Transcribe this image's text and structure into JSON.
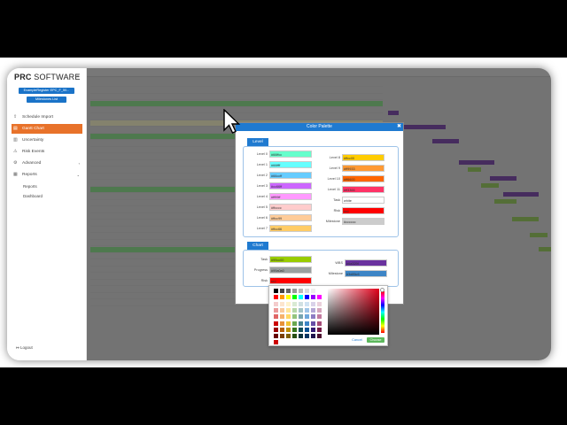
{
  "app": {
    "logo_bold": "RC",
    "logo_light": " SOFTWARE",
    "logo_prefix": "P"
  },
  "sidebar": {
    "project_button": "ExampleRegister EPC_F_50...",
    "milestone_button": "Milestones List",
    "items": [
      {
        "label": "Schedule Import",
        "icon": "upload-icon"
      },
      {
        "label": "Gantt Chart",
        "icon": "gantt-icon",
        "active": true
      },
      {
        "label": "Uncertainty",
        "icon": "chart-icon"
      },
      {
        "label": "Risk Events",
        "icon": "warning-icon"
      },
      {
        "label": "Advanced",
        "icon": "gear-icon"
      },
      {
        "label": "Reports",
        "icon": "report-icon"
      }
    ],
    "sub_items": [
      "Reports",
      "Dashboard"
    ],
    "logout": "Logout"
  },
  "modal": {
    "title": "Color Palette",
    "level_section": "Level",
    "chart_section": "Chart",
    "levels_left": [
      {
        "label": "Level 0",
        "value": "#66ffcc",
        "color": "#66ffcc"
      },
      {
        "label": "Level 1",
        "value": "#66ffff",
        "color": "#66ffff"
      },
      {
        "label": "Level 2",
        "value": "#66ccff",
        "color": "#66ccff"
      },
      {
        "label": "Level 3",
        "value": "#cc66ff",
        "color": "#cc66ff"
      },
      {
        "label": "Level 4",
        "value": "#ff99ff",
        "color": "#ff99ff"
      },
      {
        "label": "Level 5",
        "value": "#ffcccc",
        "color": "#ffcccc"
      },
      {
        "label": "Level 6",
        "value": "#ffcc99",
        "color": "#ffcc99"
      },
      {
        "label": "Level 7",
        "value": "#ffcc66",
        "color": "#ffcc66"
      }
    ],
    "levels_right": [
      {
        "label": "Level 8",
        "value": "#ffcc00",
        "color": "#ffcc00"
      },
      {
        "label": "Level 9",
        "value": "#ff9933",
        "color": "#ff9933"
      },
      {
        "label": "Level 10",
        "value": "#ff6600",
        "color": "#ff6600"
      },
      {
        "label": "Level 11",
        "value": "#ff3366",
        "color": "#ff3366"
      },
      {
        "label": "Task",
        "value": "white",
        "color": "#ffffff"
      },
      {
        "label": "Risk",
        "value": "red",
        "color": "#ff0000"
      },
      {
        "label": "Milestone",
        "value": "#cccccc",
        "color": "#cccccc"
      }
    ],
    "chart_left": [
      {
        "label": "Task",
        "value": "#99cc00",
        "color": "#99cc00"
      },
      {
        "label": "Progress",
        "value": "#99a0a0",
        "color": "#99a0a0"
      },
      {
        "label": "Risk",
        "value": "red",
        "color": "#ff0000"
      }
    ],
    "chart_right": [
      {
        "label": "WBS",
        "value": "#6a329f",
        "color": "#6a329f"
      },
      {
        "label": "Milestone",
        "value": "#3d85c6",
        "color": "#3d85c6"
      }
    ]
  },
  "picker": {
    "cancel_label": "Cancel",
    "choose_label": "Choose"
  },
  "colors": {
    "accent": "#1f7ad0",
    "active_nav": "#e8722a",
    "gantt_group": "#6a329f",
    "gantt_task": "#8bc34a"
  }
}
